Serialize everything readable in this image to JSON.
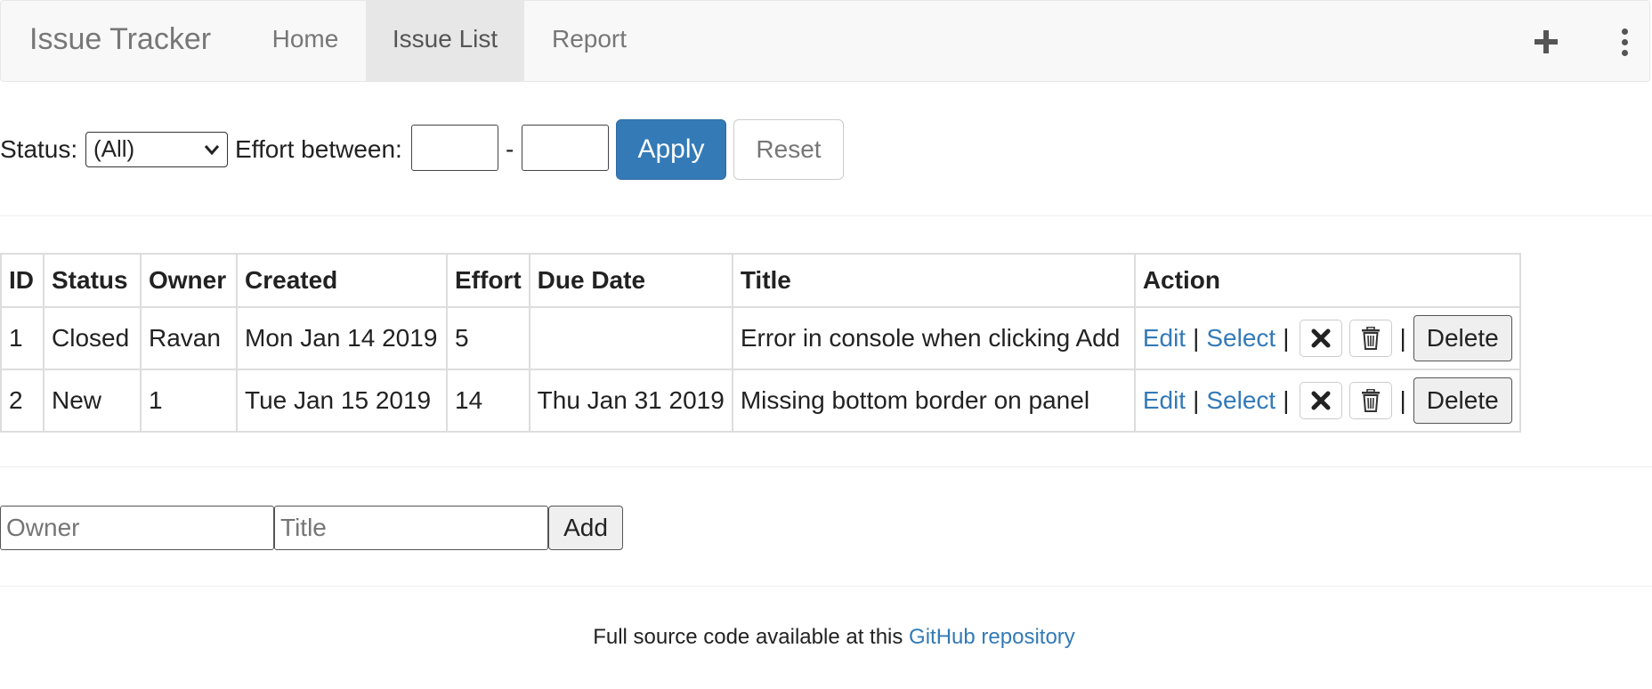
{
  "navbar": {
    "brand": "Issue Tracker",
    "items": [
      {
        "label": "Home"
      },
      {
        "label": "Issue List",
        "active": true
      },
      {
        "label": "Report"
      }
    ],
    "add_icon": "plus-icon",
    "more_icon": "vertical-ellipsis-icon"
  },
  "filter": {
    "status_label": "Status:",
    "status_value": "(All)",
    "effort_label": "Effort between:",
    "dash": "-",
    "effort_min": "",
    "effort_max": "",
    "apply_label": "Apply",
    "reset_label": "Reset"
  },
  "table": {
    "headers": [
      "ID",
      "Status",
      "Owner",
      "Created",
      "Effort",
      "Due Date",
      "Title",
      "Action"
    ],
    "rows": [
      {
        "id": "1",
        "status": "Closed",
        "owner": "Ravan",
        "created": "Mon Jan 14 2019",
        "effort": "5",
        "due": "",
        "title": "Error in console when clicking Add"
      },
      {
        "id": "2",
        "status": "New",
        "owner": "1",
        "created": "Tue Jan 15 2019",
        "effort": "14",
        "due": "Thu Jan 31 2019",
        "title": "Missing bottom border on panel"
      }
    ],
    "actions": {
      "edit": "Edit",
      "select": "Select",
      "separator": "|",
      "close_icon": "close-x-icon",
      "delete_icon": "trash-icon",
      "delete_label": "Delete"
    }
  },
  "add_form": {
    "owner_placeholder": "Owner",
    "title_placeholder": "Title",
    "add_label": "Add"
  },
  "footer": {
    "text": "Full source code available at this",
    "link": "GitHub repository"
  },
  "colors": {
    "primary": "#337ab7",
    "navbar_bg": "#f8f8f8",
    "active_tab_bg": "#e7e7e7"
  }
}
